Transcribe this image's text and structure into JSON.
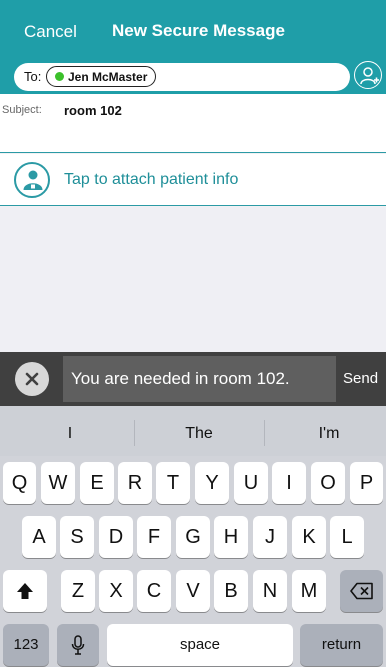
{
  "header": {
    "cancel_label": "Cancel",
    "title": "New Secure Message"
  },
  "recipients": {
    "to_label": "To:",
    "chip_name": "Jen McMaster",
    "chip_status_color": "#3cc12b",
    "add_icon": "add-person-icon"
  },
  "subject": {
    "label": "Subject:",
    "value": "room 102"
  },
  "attach": {
    "label": "Tap to attach patient info",
    "icon": "patient-icon"
  },
  "compose": {
    "message": "You are needed in room 102.",
    "send_label": "Send",
    "clear_icon": "close-icon"
  },
  "keyboard": {
    "suggestions": [
      "I",
      "The",
      "I'm"
    ],
    "row1": [
      "Q",
      "W",
      "E",
      "R",
      "T",
      "Y",
      "U",
      "I",
      "O",
      "P"
    ],
    "row2": [
      "A",
      "S",
      "D",
      "F",
      "G",
      "H",
      "J",
      "K",
      "L"
    ],
    "row3": [
      "Z",
      "X",
      "C",
      "V",
      "B",
      "N",
      "M"
    ],
    "numbers_label": "123",
    "space_label": "space",
    "return_label": "return",
    "shift_icon": "shift-icon",
    "delete_icon": "backspace-icon",
    "mic_icon": "microphone-icon"
  },
  "colors": {
    "brand_teal": "#1f9ea8",
    "compose_bg": "#404040",
    "keyboard_bg": "#d1d3d9"
  }
}
